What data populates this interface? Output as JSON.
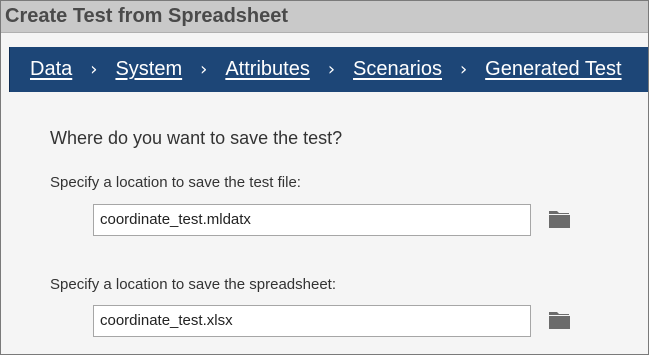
{
  "window": {
    "title": "Create Test from Spreadsheet"
  },
  "nav": {
    "items": [
      {
        "label": "Data"
      },
      {
        "label": "System"
      },
      {
        "label": "Attributes"
      },
      {
        "label": "Scenarios"
      },
      {
        "label": "Generated Test"
      }
    ],
    "separator": "›",
    "background_color": "#1d4677"
  },
  "main": {
    "question": "Where do you want to save the test?",
    "test_file": {
      "label": "Specify a location to save the test file:",
      "value": "coordinate_test.mldatx",
      "browse_icon": "folder-icon"
    },
    "spreadsheet": {
      "label": "Specify a location to save the spreadsheet:",
      "value": "coordinate_test.xlsx",
      "browse_icon": "folder-icon"
    }
  }
}
